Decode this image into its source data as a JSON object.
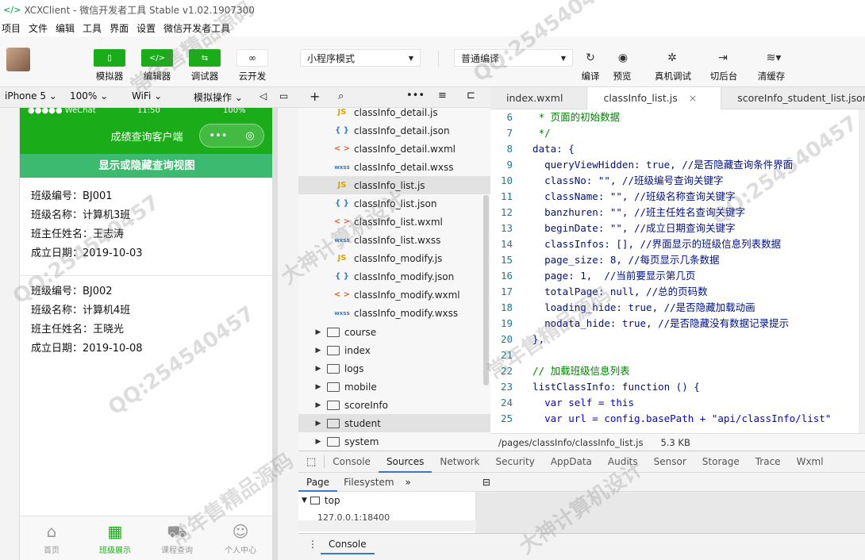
{
  "window": {
    "title": "XCXClient - 微信开发者工具 Stable v1.02.1907300",
    "logo": "</>"
  },
  "menu": [
    "项目",
    "文件",
    "编辑",
    "工具",
    "界面",
    "设置",
    "微信开发者工具"
  ],
  "toolbar": {
    "simulator": "模拟器",
    "editor": "编辑器",
    "debugger": "调试器",
    "cloud": "云开发",
    "mode_select": "小程序模式",
    "compile_select": "普通编译",
    "compile": "编译",
    "preview": "预览",
    "real_debug": "真机调试",
    "background": "切后台",
    "clear_cache": "清缓存"
  },
  "subbar": {
    "device": "iPhone 5",
    "zoom": "100%",
    "network": "WiFi",
    "sim_ops": "模拟操作"
  },
  "phone": {
    "status_left": "●●●●● WeChat",
    "status_time": "11:50",
    "status_right": "100%",
    "nav_title": "成绩查询客户端",
    "capsule_dots": "•••",
    "capsule_circle": "◎",
    "toggle_btn": "显示或隐藏查询视图",
    "cards": [
      {
        "no": "班级编号：BJ001",
        "name": "班级名称：计算机3班",
        "teacher": "班主任姓名：王志涛",
        "date": "成立日期：2019-10-03"
      },
      {
        "no": "班级编号：BJ002",
        "name": "班级名称：计算机4班",
        "teacher": "班主任姓名：王晓光",
        "date": "成立日期：2019-10-08"
      }
    ],
    "tabs": [
      {
        "label": "首页",
        "icon": "home-icon"
      },
      {
        "label": "班级展示",
        "icon": "grid-icon"
      },
      {
        "label": "课程查询",
        "icon": "cart-icon"
      },
      {
        "label": "个人中心",
        "icon": "person-icon"
      }
    ]
  },
  "files": [
    {
      "type": "json",
      "icon": "{ }",
      "name": "classInfo_detail.js"
    },
    {
      "type": "json",
      "icon": "{ }",
      "name": "classInfo_detail.json"
    },
    {
      "type": "wxml",
      "icon": "< >",
      "name": "classInfo_detail.wxml"
    },
    {
      "type": "wxss",
      "icon": "wxss",
      "name": "classInfo_detail.wxss"
    },
    {
      "type": "js",
      "icon": "JS",
      "name": "classInfo_list.js"
    },
    {
      "type": "json",
      "icon": "{ }",
      "name": "classInfo_list.json"
    },
    {
      "type": "wxml",
      "icon": "< >",
      "name": "classInfo_list.wxml"
    },
    {
      "type": "wxss",
      "icon": "wxss",
      "name": "classInfo_list.wxss"
    },
    {
      "type": "js",
      "icon": "JS",
      "name": "classInfo_modify.js"
    },
    {
      "type": "json",
      "icon": "{ }",
      "name": "classInfo_modify.json"
    },
    {
      "type": "wxml",
      "icon": "< >",
      "name": "classInfo_modify.wxml"
    },
    {
      "type": "wxss",
      "icon": "wxss",
      "name": "classInfo_modify.wxss"
    }
  ],
  "folders": [
    "course",
    "index",
    "logs",
    "mobile",
    "scoreInfo",
    "student",
    "system"
  ],
  "editor_tabs": [
    "index.wxml",
    "classInfo_list.js",
    "scoreInfo_student_list.json"
  ],
  "code": [
    {
      "n": "6",
      "t": "   * 页面的初始数据"
    },
    {
      "n": "7",
      "t": "   */"
    },
    {
      "n": "8",
      "t": "  data: {"
    },
    {
      "n": "9",
      "t": "    queryViewHidden: true, //是否隐藏查询条件界面"
    },
    {
      "n": "10",
      "t": "    classNo: \"\", //班级编号查询关键字"
    },
    {
      "n": "11",
      "t": "    className: \"\", //班级名称查询关键字"
    },
    {
      "n": "12",
      "t": "    banzhuren: \"\", //班主任姓名查询关键字"
    },
    {
      "n": "13",
      "t": "    beginDate: \"\", //成立日期查询关键字"
    },
    {
      "n": "14",
      "t": "    classInfos: [], //界面显示的班级信息列表数据"
    },
    {
      "n": "15",
      "t": "    page_size: 8, //每页显示几条数据"
    },
    {
      "n": "16",
      "t": "    page: 1,  //当前要显示第几页"
    },
    {
      "n": "17",
      "t": "    totalPage: null, //总的页码数"
    },
    {
      "n": "18",
      "t": "    loading_hide: true, //是否隐藏加载动画"
    },
    {
      "n": "19",
      "t": "    nodata_hide: true, //是否隐藏没有数据记录提示"
    },
    {
      "n": "20",
      "t": "  },"
    },
    {
      "n": "21",
      "t": ""
    },
    {
      "n": "22",
      "t": "  // 加载班级信息列表"
    },
    {
      "n": "23",
      "t": "  listClassInfo: function () {"
    },
    {
      "n": "24",
      "t": "    var self = this"
    },
    {
      "n": "25",
      "t": "    var url = config.basePath + \"api/classInfo/list\""
    }
  ],
  "fileinfo": {
    "path": "/pages/classInfo/classInfo_list.js",
    "size": "5.3 KB"
  },
  "devtools_tabs": [
    "Console",
    "Sources",
    "Network",
    "Security",
    "AppData",
    "Audits",
    "Sensor",
    "Storage",
    "Trace",
    "Wxml"
  ],
  "sources": {
    "page_tab": "Page",
    "fs_tab": "Filesystem",
    "more": "»",
    "top": "top",
    "host": "127.0.0.1:18400"
  },
  "console_label": "Console",
  "watermarks": [
    "QQ:254540457",
    "常年售精品源码",
    "大神计算机设计"
  ]
}
